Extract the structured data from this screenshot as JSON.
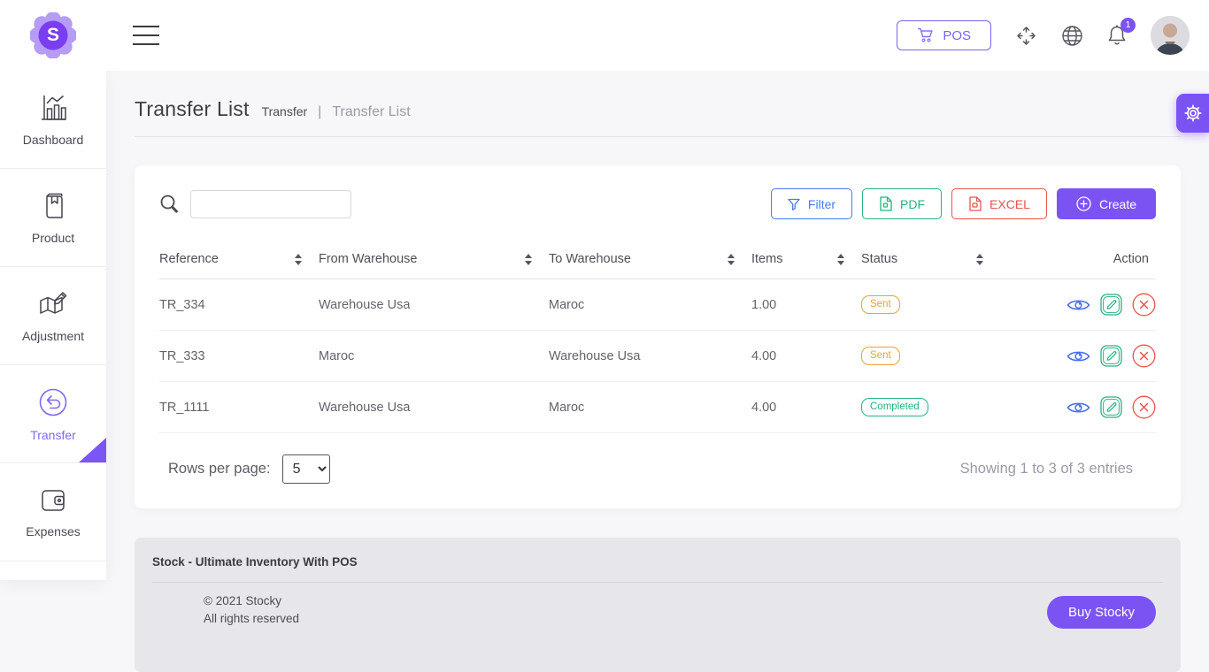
{
  "header": {
    "logo_letter": "S",
    "pos_button": "POS",
    "notification_count": "1"
  },
  "sidebar": {
    "items": [
      {
        "label": "Dashboard"
      },
      {
        "label": "Product"
      },
      {
        "label": "Adjustment"
      },
      {
        "label": "Transfer",
        "active": true
      },
      {
        "label": "Expenses"
      }
    ]
  },
  "page": {
    "title": "Transfer List",
    "breadcrumb": [
      "Transfer",
      "Transfer List"
    ],
    "separator": "|"
  },
  "toolbar": {
    "search_value": "",
    "filter_label": "Filter",
    "pdf_label": "PDF",
    "excel_label": "EXCEL",
    "create_label": "Create"
  },
  "table": {
    "headers": [
      "Reference",
      "From Warehouse",
      "To Warehouse",
      "Items",
      "Status",
      "Action"
    ],
    "rows": [
      {
        "reference": "TR_334",
        "from": "Warehouse Usa",
        "to": "Maroc",
        "items": "1.00",
        "status": "Sent",
        "status_type": "warning"
      },
      {
        "reference": "TR_333",
        "from": "Maroc",
        "to": "Warehouse Usa",
        "items": "4.00",
        "status": "Sent",
        "status_type": "warning"
      },
      {
        "reference": "TR_1111",
        "from": "Warehouse Usa",
        "to": "Maroc",
        "items": "4.00",
        "status": "Completed",
        "status_type": "success"
      }
    ]
  },
  "pagination": {
    "rows_per_page_label": "Rows per page:",
    "rows_per_page_value": "5",
    "showing_text": "Showing 1 to 3 of 3 entries"
  },
  "footer": {
    "title": "Stock - Ultimate Inventory With POS",
    "copyright": "© 2021 Stocky",
    "rights": "All rights reserved",
    "buy_button": "Buy Stocky"
  },
  "colors": {
    "purple": "#7c53f3",
    "blue": "#447df0",
    "green": "#24b47e",
    "red": "#e8544e",
    "orange": "#f1a12f"
  }
}
